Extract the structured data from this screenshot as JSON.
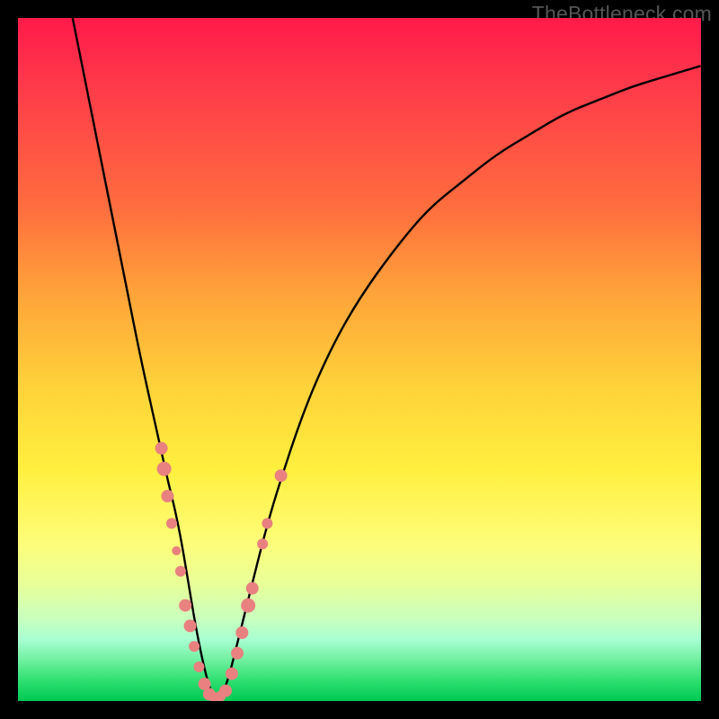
{
  "watermark": "TheBottleneck.com",
  "colors": {
    "frame": "#000000",
    "watermark": "#555555",
    "curve": "#000000",
    "marker_fill": "#e8817f",
    "marker_stroke": "#b85a58",
    "gradient_stops": [
      "#ff1a4a",
      "#ff3a4a",
      "#ff6e3e",
      "#ffa23a",
      "#ffd23a",
      "#ffef3e",
      "#fdfd7a",
      "#e8ff9a",
      "#c8ffbe",
      "#a8ffd2",
      "#70f0a0",
      "#2ee070",
      "#00c853"
    ]
  },
  "chart_data": {
    "type": "line",
    "title": "",
    "xlabel": "",
    "ylabel": "",
    "xlim": [
      0,
      100
    ],
    "ylim": [
      0,
      100
    ],
    "grid": false,
    "legend": false,
    "series": [
      {
        "name": "bottleneck-curve",
        "x": [
          8,
          10,
          12,
          14,
          16,
          18,
          20,
          22,
          23,
          24,
          25,
          26,
          27,
          28,
          29,
          30,
          31,
          32,
          34,
          36,
          38,
          42,
          46,
          50,
          55,
          60,
          65,
          70,
          75,
          80,
          85,
          90,
          95,
          100
        ],
        "y": [
          100,
          90,
          80,
          70,
          60,
          50,
          41,
          32,
          28,
          23,
          17,
          11,
          6,
          2,
          0,
          1,
          4,
          8,
          16,
          24,
          31,
          43,
          52,
          59,
          66,
          72,
          76,
          80,
          83,
          86,
          88,
          90,
          91.5,
          93
        ]
      }
    ],
    "markers": [
      {
        "x": 21.0,
        "y": 37,
        "r": 7
      },
      {
        "x": 21.4,
        "y": 34,
        "r": 8
      },
      {
        "x": 21.9,
        "y": 30,
        "r": 7
      },
      {
        "x": 22.5,
        "y": 26,
        "r": 6
      },
      {
        "x": 23.2,
        "y": 22,
        "r": 5
      },
      {
        "x": 23.8,
        "y": 19,
        "r": 6
      },
      {
        "x": 24.5,
        "y": 14,
        "r": 7
      },
      {
        "x": 25.2,
        "y": 11,
        "r": 7
      },
      {
        "x": 25.8,
        "y": 8,
        "r": 6
      },
      {
        "x": 26.5,
        "y": 5,
        "r": 6
      },
      {
        "x": 27.3,
        "y": 2.5,
        "r": 7
      },
      {
        "x": 28.0,
        "y": 1,
        "r": 7
      },
      {
        "x": 28.8,
        "y": 0.5,
        "r": 6
      },
      {
        "x": 29.6,
        "y": 0.7,
        "r": 6
      },
      {
        "x": 30.4,
        "y": 1.5,
        "r": 7
      },
      {
        "x": 31.3,
        "y": 4,
        "r": 7
      },
      {
        "x": 32.1,
        "y": 7,
        "r": 7
      },
      {
        "x": 32.8,
        "y": 10,
        "r": 7
      },
      {
        "x": 33.7,
        "y": 14,
        "r": 8
      },
      {
        "x": 34.3,
        "y": 16.5,
        "r": 7
      },
      {
        "x": 35.8,
        "y": 23,
        "r": 6
      },
      {
        "x": 36.5,
        "y": 26,
        "r": 6
      },
      {
        "x": 38.5,
        "y": 33,
        "r": 7
      }
    ]
  }
}
